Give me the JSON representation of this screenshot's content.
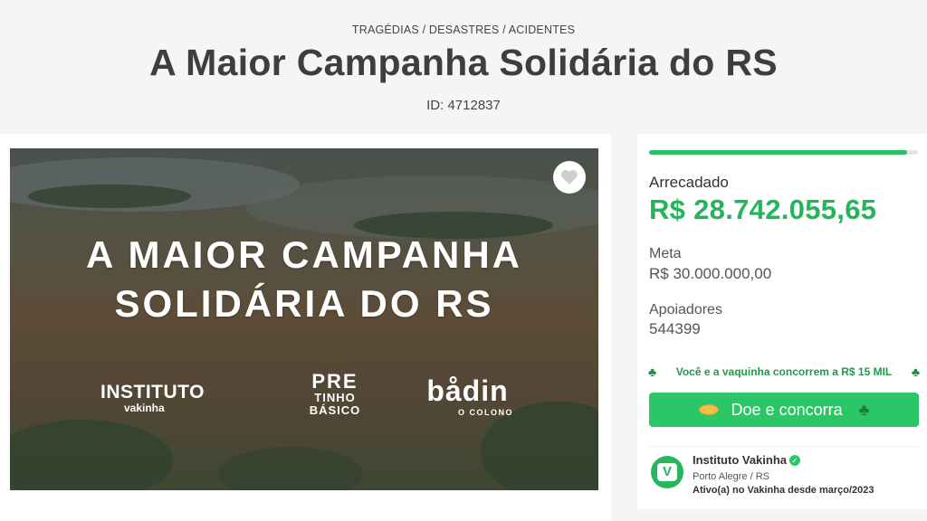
{
  "header": {
    "category": "TRAGÉDIAS / DESASTRES / ACIDENTES",
    "title": "A Maior Campanha Solidária do RS",
    "id_text": "ID: 4712837"
  },
  "hero": {
    "headline_line1": "A MAIOR CAMPANHA",
    "headline_line2": "SOLIDÁRIA DO RS",
    "logos": {
      "instituto": "INSTITUTO",
      "vakinha": "vakinha",
      "pretinho_top": "PRE",
      "pretinho_mid": "TINHO",
      "pretinho_bottom": "BÁSICO",
      "badin": "bådin",
      "badin_sub": "O COLONO"
    },
    "favorite_icon": "heart-icon"
  },
  "campaign": {
    "progress_fraction": 0.958,
    "raised_label": "Arrecadado",
    "raised_value": "R$ 28.742.055,65",
    "goal_label": "Meta",
    "goal_value": "R$ 30.000.000,00",
    "supporters_label": "Apoiadores",
    "supporters_value": "544399",
    "promo_text": "Você e a vaquinha concorrem a R$ 15 MIL",
    "donate_button_label": "Doe e concorra"
  },
  "organizer": {
    "name": "Instituto Vakinha",
    "location": "Porto Alegre / RS",
    "since": "Ativo(a) no Vakinha desde março/2023"
  },
  "colors": {
    "accent": "#2bc766",
    "raised": "#22b55b",
    "background": "#f5f5f5"
  }
}
